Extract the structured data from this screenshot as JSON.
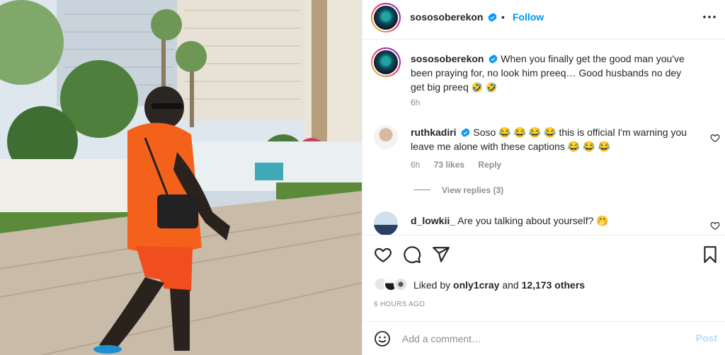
{
  "post": {
    "author": "sososoberekon",
    "follow_label": "Follow",
    "separator": "•",
    "caption": {
      "text": "When you finally get the good man you've been praying for, no look him preeq… Good husbands no dey get big preeq",
      "emojis": "🤣 🤣",
      "time": "6h"
    }
  },
  "comments": [
    {
      "user": "ruthkadiri",
      "verified": true,
      "text": "Soso 😂 😂 😂 😂 this is official I'm warning you leave me alone with these captions 😂 😂 😂",
      "time": "6h",
      "likes": "73 likes",
      "reply_label": "Reply",
      "view_replies": "View replies (3)"
    },
    {
      "user": "d_lowkii_",
      "verified": false,
      "text": "Are you talking about yourself? 🤭"
    }
  ],
  "engagement": {
    "liked_prefix": "Liked by",
    "liked_by_user": "only1cray",
    "liked_and": "and",
    "others": "12,173 others",
    "time_ago": "6 HOURS AGO"
  },
  "composer": {
    "placeholder": "Add a comment…",
    "post_label": "Post"
  },
  "icons": {
    "more": "more-options-icon",
    "verified": "verified-badge-icon",
    "like": "heart-icon",
    "comment": "comment-bubble-icon",
    "share": "paper-plane-icon",
    "save": "bookmark-icon",
    "emoji": "emoji-smiley-icon"
  },
  "colors": {
    "accent": "#0095f6",
    "muted": "#8e8e8e",
    "post_disabled": "#b2dffc"
  }
}
